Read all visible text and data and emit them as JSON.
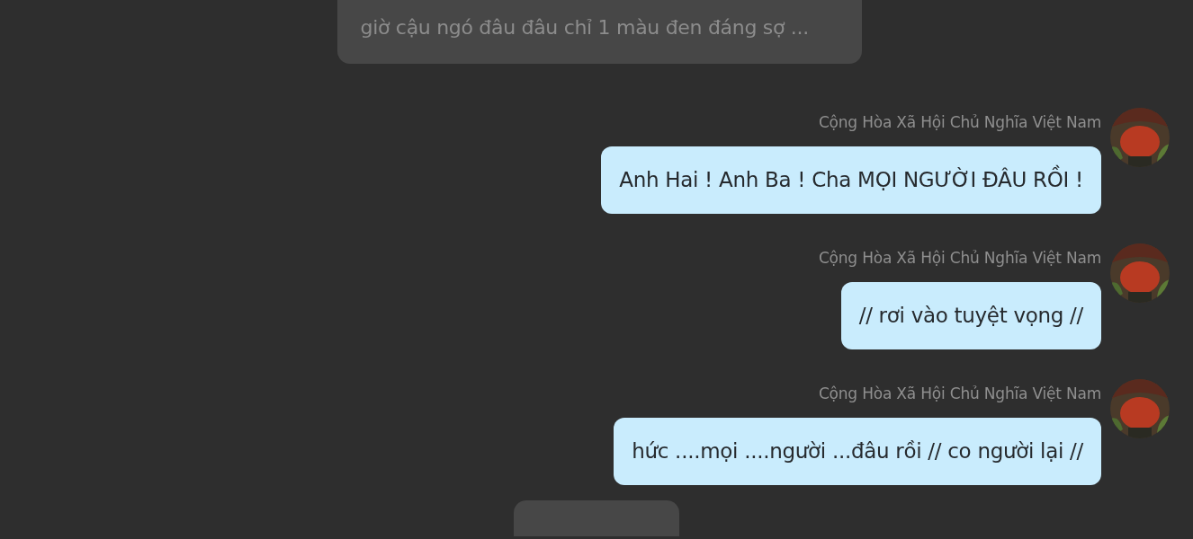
{
  "messages": [
    {
      "kind": "narration",
      "text": "giờ cậu ngó đâu đâu chỉ 1 màu đen đáng sợ ..."
    },
    {
      "kind": "own",
      "sender": "Cộng Hòa Xã Hội Chủ Nghĩa Việt Nam",
      "text": "Anh Hai ! Anh Ba ! Cha MỌI NGƯỜI ĐÂU RỒI !"
    },
    {
      "kind": "own",
      "sender": "Cộng Hòa Xã Hội Chủ Nghĩa Việt Nam",
      "text": "// rơi vào tuyệt vọng //"
    },
    {
      "kind": "own",
      "sender": "Cộng Hòa Xã Hội Chủ Nghĩa Việt Nam",
      "text": "hức ....mọi ....người ...đâu rồi // co người lại //"
    },
    {
      "kind": "narration"
    }
  ]
}
